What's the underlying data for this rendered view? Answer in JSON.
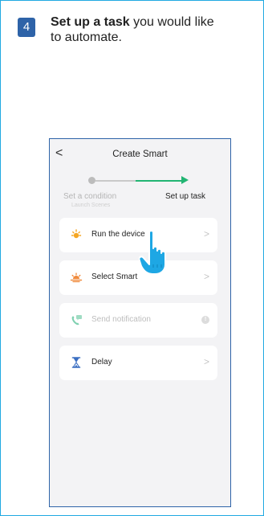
{
  "instruction": {
    "step_number": "4",
    "bold_text": "Set up a task",
    "rest_text": " you would like to automate."
  },
  "phone": {
    "title": "Create Smart",
    "back_glyph": "<",
    "progress": {
      "step1_label": "Set a condition",
      "step1_sublabel": "Launch Scenes",
      "step2_label": "Set up task"
    },
    "items": [
      {
        "label": "Run the device",
        "icon": "sun-icon",
        "enabled": true
      },
      {
        "label": "Select Smart",
        "icon": "sunrise-icon",
        "enabled": true
      },
      {
        "label": "Send notification",
        "icon": "notification-phone-icon",
        "enabled": false
      },
      {
        "label": "Delay",
        "icon": "hourglass-icon",
        "enabled": true
      }
    ],
    "chevron": ">",
    "info_glyph": "!"
  },
  "colors": {
    "frame_border": "#21a9e1",
    "step_badge": "#2e63a8",
    "progress_green": "#22b573",
    "hand": "#1ea7e4"
  }
}
